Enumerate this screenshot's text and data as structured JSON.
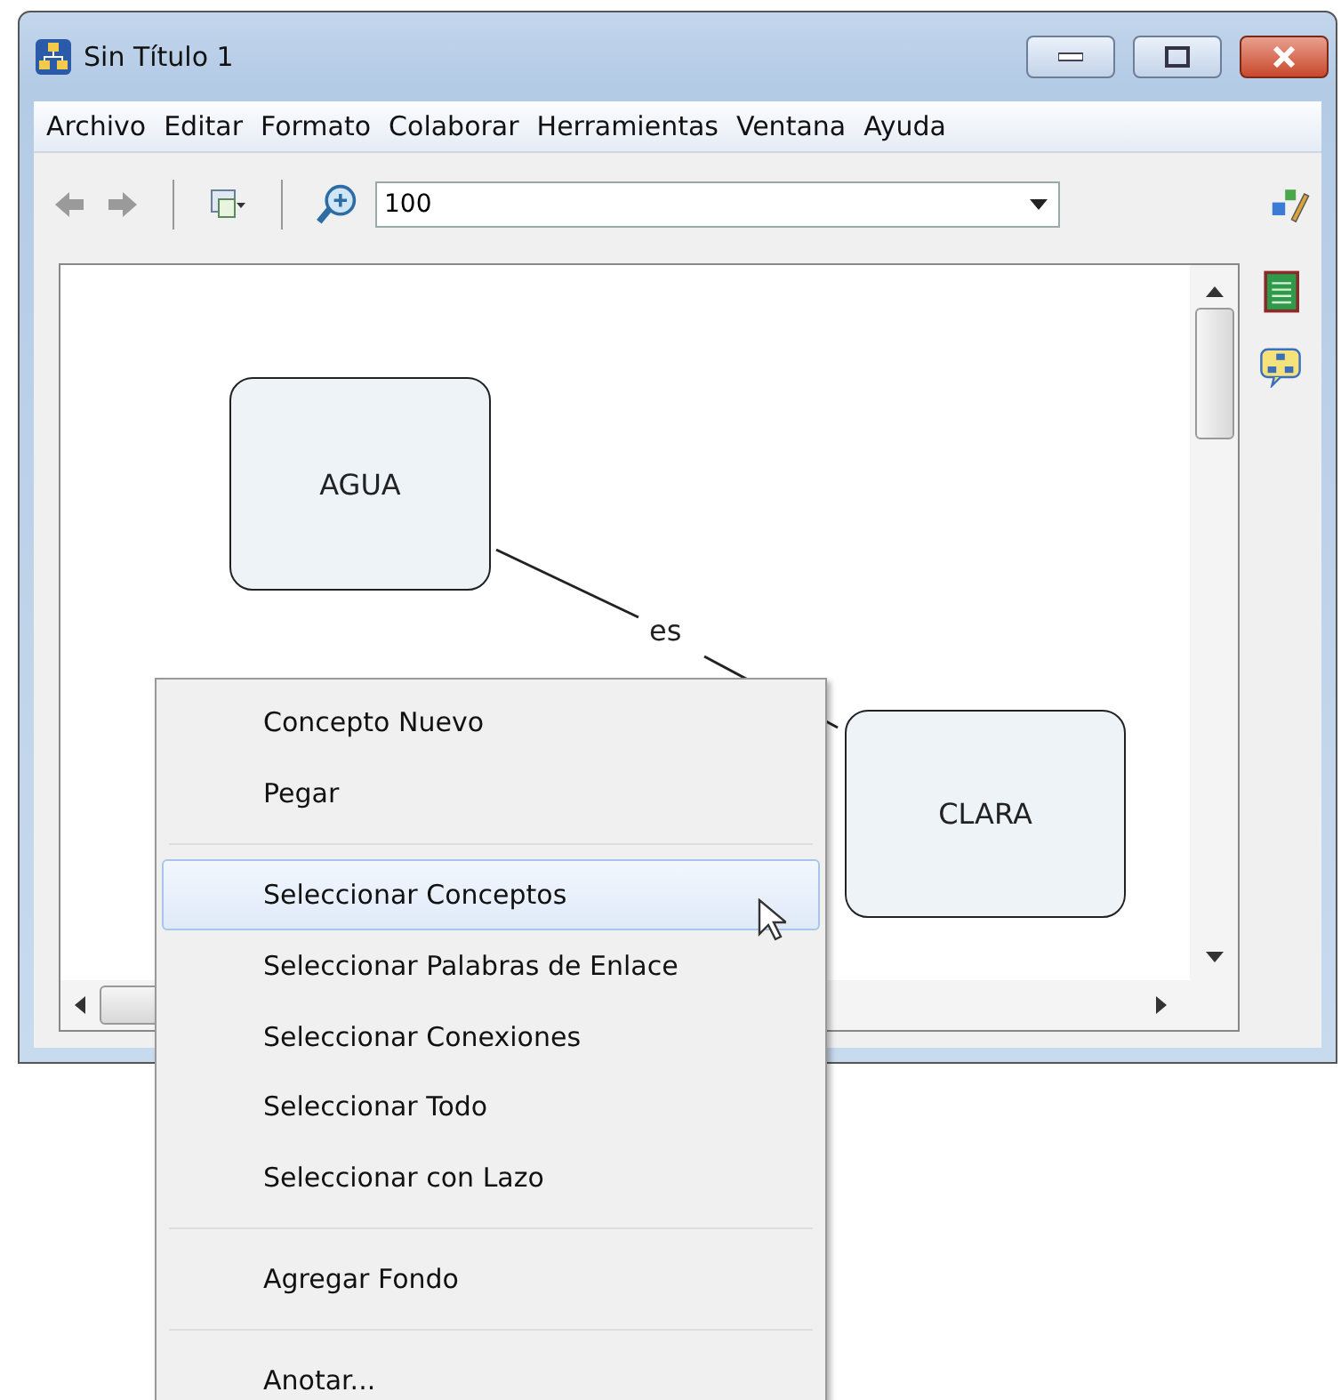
{
  "window": {
    "title": "Sin Título 1"
  },
  "menu_bar": [
    "Archivo",
    "Editar",
    "Formato",
    "Colaborar",
    "Herramientas",
    "Ventana",
    "Ayuda"
  ],
  "toolbar": {
    "zoom_value": "100"
  },
  "concept_map": {
    "concepts": [
      {
        "label": "AGUA"
      },
      {
        "label": "CLARA"
      }
    ],
    "linking_phrases": [
      {
        "label": "es"
      }
    ]
  },
  "context_menu": [
    {
      "kind": "item",
      "label": "Concepto Nuevo",
      "selected": false
    },
    {
      "kind": "item",
      "label": "Pegar",
      "selected": false
    },
    {
      "kind": "separator"
    },
    {
      "kind": "item",
      "label": "Seleccionar Conceptos",
      "selected": true
    },
    {
      "kind": "item",
      "label": "Seleccionar Palabras de Enlace",
      "selected": false
    },
    {
      "kind": "item",
      "label": "Seleccionar Conexiones",
      "selected": false
    },
    {
      "kind": "item",
      "label": "Seleccionar Todo",
      "selected": false
    },
    {
      "kind": "item",
      "label": "Seleccionar con Lazo",
      "selected": false
    },
    {
      "kind": "separator"
    },
    {
      "kind": "item",
      "label": "Agregar Fondo",
      "selected": false
    },
    {
      "kind": "separator"
    },
    {
      "kind": "item",
      "label": "Anotar...",
      "selected": false
    }
  ]
}
